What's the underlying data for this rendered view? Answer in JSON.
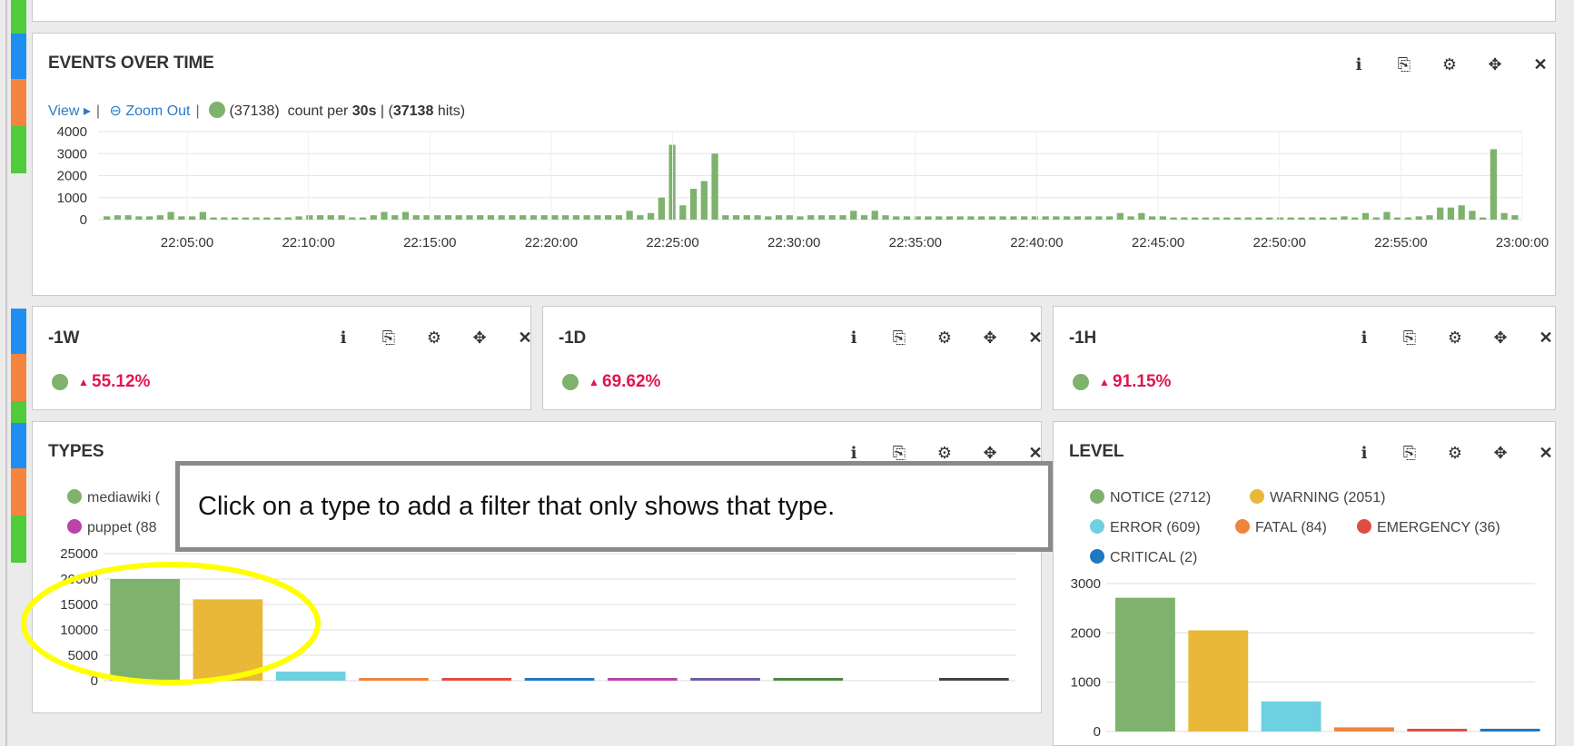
{
  "events_panel": {
    "title": "EVENTS OVER TIME",
    "view_label": "View",
    "zoom_out_label": "Zoom Out",
    "series_count": "(37138)",
    "count_per": "count per",
    "interval": "30s",
    "hits_count": "37138",
    "hits_label": "hits"
  },
  "panel_icons": {
    "info": "info-icon",
    "copy": "copy-icon",
    "settings": "gear-icon",
    "move": "move-icon",
    "close": "close-icon"
  },
  "trend_panels": [
    {
      "title": "-1W",
      "value": "55.12%"
    },
    {
      "title": "-1D",
      "value": "69.62%"
    },
    {
      "title": "-1H",
      "value": "91.15%"
    }
  ],
  "types_panel": {
    "title": "TYPES",
    "legend": [
      "mediawiki (",
      "puppet (88"
    ]
  },
  "level_panel": {
    "title": "LEVEL",
    "legend": [
      {
        "label": "NOTICE (2712)",
        "color": "#7eb26d"
      },
      {
        "label": "WARNING (2051)",
        "color": "#eab839"
      },
      {
        "label": "ERROR (609)",
        "color": "#6ed0e0"
      },
      {
        "label": "FATAL (84)",
        "color": "#ef843c"
      },
      {
        "label": "EMERGENCY (36)",
        "color": "#e24d42"
      },
      {
        "label": "CRITICAL (2)",
        "color": "#1f78c1"
      }
    ]
  },
  "tooltip": {
    "text": "Click on a type to add a filter that only shows that type."
  },
  "colors": {
    "accent_green": "#7eb26d",
    "link_blue": "#2a7cc7",
    "trend_red": "#e0164f",
    "highlight_yellow": "#ffff00"
  },
  "chart_data": [
    {
      "type": "bar",
      "name": "events-over-time",
      "ylim": [
        0,
        4000
      ],
      "yticks": [
        "4000",
        "3000",
        "2000",
        "1000",
        "0"
      ],
      "xticks": [
        "22:05:00",
        "22:10:00",
        "22:15:00",
        "22:20:00",
        "22:25:00",
        "22:30:00",
        "22:35:00",
        "22:40:00",
        "22:45:00",
        "22:50:00",
        "22:55:00",
        "23:00:00"
      ],
      "values": [
        150,
        200,
        200,
        150,
        150,
        200,
        350,
        150,
        150,
        350,
        100,
        100,
        100,
        100,
        100,
        100,
        100,
        100,
        150,
        200,
        200,
        200,
        200,
        100,
        100,
        200,
        350,
        200,
        350,
        200,
        200,
        200,
        200,
        200,
        200,
        200,
        200,
        200,
        200,
        200,
        200,
        200,
        200,
        200,
        200,
        200,
        200,
        200,
        200,
        400,
        200,
        300,
        1000,
        3400,
        650,
        1400,
        1750,
        3000,
        200,
        200,
        200,
        200,
        150,
        200,
        200,
        150,
        200,
        200,
        200,
        200,
        400,
        200,
        400,
        200,
        150,
        150,
        150,
        150,
        150,
        150,
        150,
        150,
        150,
        150,
        150,
        150,
        150,
        150,
        150,
        150,
        150,
        150,
        150,
        150,
        150,
        300,
        150,
        300,
        150,
        150,
        100,
        100,
        100,
        100,
        100,
        100,
        100,
        100,
        100,
        100,
        100,
        100,
        100,
        100,
        100,
        100,
        150,
        100,
        300,
        100,
        350,
        100,
        100,
        150,
        200,
        550,
        550,
        650,
        400,
        100,
        3200,
        300,
        200
      ]
    },
    {
      "type": "bar",
      "name": "types",
      "ylim": [
        0,
        25000
      ],
      "yticks": [
        "25000",
        "20000",
        "15000",
        "10000",
        "5000",
        "0"
      ],
      "values": [
        20000,
        16000,
        1800,
        500,
        400,
        400,
        300,
        250,
        250,
        0,
        200
      ],
      "colors": [
        "#7eb26d",
        "#eab839",
        "#6ed0e0",
        "#ef843c",
        "#e24d42",
        "#1f78c1",
        "#ba43a9",
        "#705da0",
        "#508642",
        "#cca300",
        "#444444"
      ]
    },
    {
      "type": "bar",
      "name": "level",
      "categories": [
        "NOTICE",
        "WARNING",
        "ERROR",
        "FATAL",
        "EMERGENCY",
        "CRITICAL"
      ],
      "ylim": [
        0,
        3000
      ],
      "yticks": [
        "3000",
        "2000",
        "1000",
        "0"
      ],
      "values": [
        2712,
        2051,
        609,
        84,
        36,
        2
      ],
      "colors": [
        "#7eb26d",
        "#eab839",
        "#6ed0e0",
        "#ef843c",
        "#e24d42",
        "#1f78c1"
      ]
    }
  ]
}
